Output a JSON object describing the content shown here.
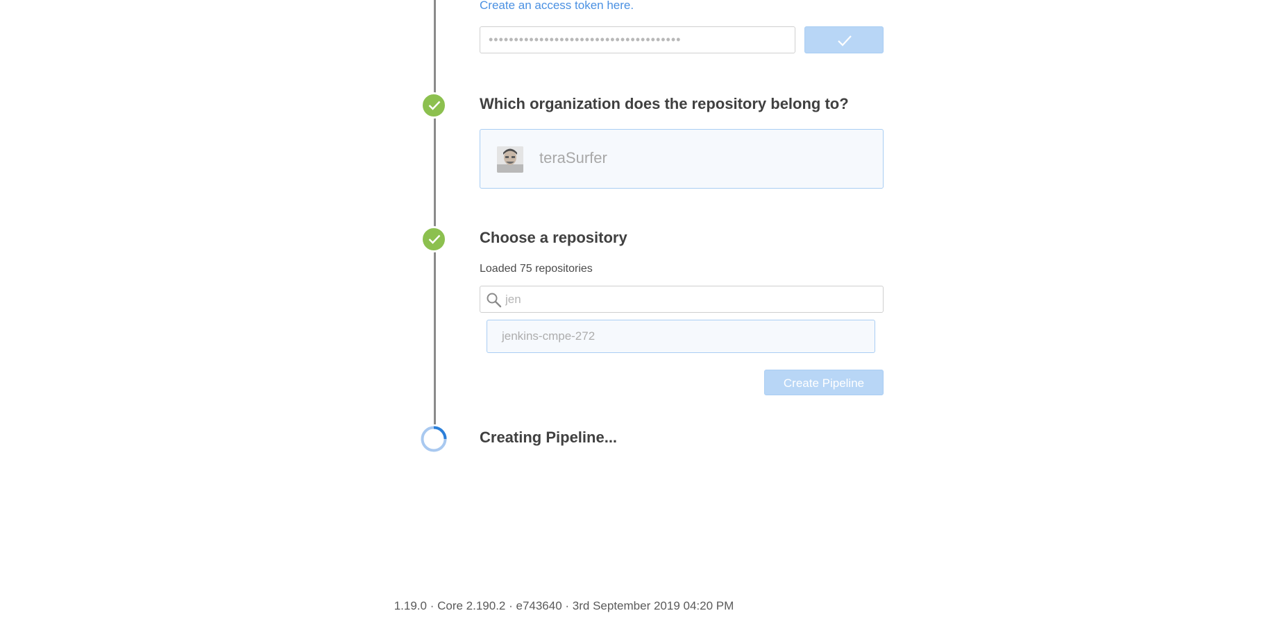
{
  "token_step": {
    "link_text": "Create an access token here.",
    "masked_token": "••••••••••••••••••••••••••••••••••••••"
  },
  "org_step": {
    "title": "Which organization does the repository belong to?",
    "selected_org": "teraSurfer"
  },
  "repo_step": {
    "title": "Choose a repository",
    "loaded_text": "Loaded 75 repositories",
    "search_value": "jen",
    "repositories": [
      "jenkins-cmpe-272"
    ],
    "create_button_label": "Create Pipeline"
  },
  "creating_step": {
    "title": "Creating Pipeline..."
  },
  "footer": {
    "version_text": "1.19.0 · Core 2.190.2 · e743640 · 3rd September 2019 04:20 PM"
  },
  "colors": {
    "success_green": "#8cc04f",
    "link_blue": "#4a90e2",
    "disabled_button_blue": "#b8d6f6",
    "selected_border": "#a9cdf3",
    "spinner_blue": "#2b7fd9"
  }
}
